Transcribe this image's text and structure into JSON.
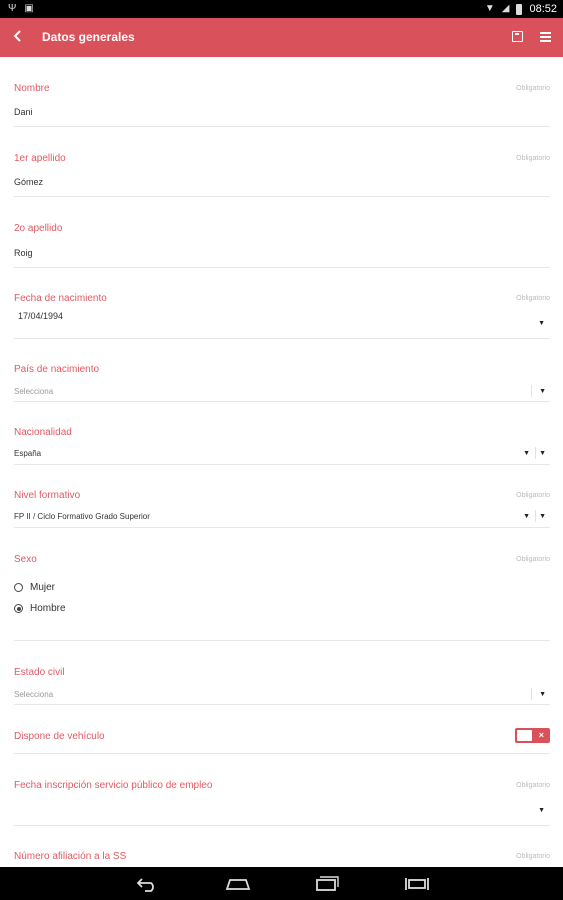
{
  "status_bar": {
    "time": "08:52",
    "icons": [
      "usb-icon",
      "sd-card-icon",
      "wifi-icon",
      "no-signal-icon",
      "battery-icon"
    ]
  },
  "app_bar": {
    "title": "Datos generales",
    "icons": [
      "back-arrow-icon",
      "save-icon",
      "menu-icon"
    ],
    "color": "#d9515b"
  },
  "form": {
    "required_text": "Obligatorio",
    "nombre": {
      "label": "Nombre",
      "value": "Dani"
    },
    "apellido1": {
      "label": "1er apellido",
      "value": "Gómez"
    },
    "apellido2": {
      "label": "2o apellido",
      "value": "Roig"
    },
    "fecha_nacimiento": {
      "label": "Fecha de nacimiento",
      "value": "17/04/1994"
    },
    "pais_nacimiento": {
      "label": "País de nacimiento",
      "placeholder": "Selecciona"
    },
    "nacionalidad": {
      "label": "Nacionalidad",
      "value": "España"
    },
    "nivel_formativo": {
      "label": "Nivel formativo",
      "value": "FP II / Ciclo Formativo Grado Superior"
    },
    "sexo": {
      "label": "Sexo",
      "options": [
        {
          "label": "Mujer",
          "selected": false
        },
        {
          "label": "Hombre",
          "selected": true
        }
      ]
    },
    "estado_civil": {
      "label": "Estado civil",
      "placeholder": "Selecciona"
    },
    "vehiculo": {
      "label": "Dispone de vehículo",
      "toggle_off_mark": "×"
    },
    "fecha_inscripcion": {
      "label": "Fecha inscripción servicio público de empleo"
    },
    "afiliacion": {
      "label": "Número afiliación a la SS"
    }
  },
  "nav_bar": {
    "icons": [
      "nav-back-icon",
      "nav-home-icon",
      "nav-recent-apps-icon",
      "nav-screen-resize-icon"
    ]
  }
}
